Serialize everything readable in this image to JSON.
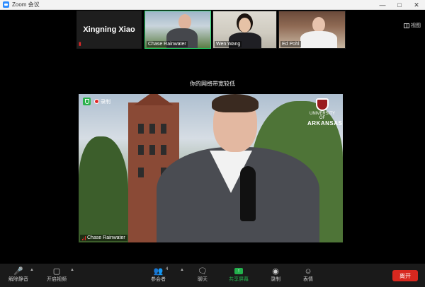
{
  "window": {
    "title": "Zoom 会议"
  },
  "gallery": {
    "view_label": "视图",
    "participants": [
      {
        "name": "Xingning Xiao",
        "video": false,
        "muted": true
      },
      {
        "name": "Chase Rainwater",
        "video": true,
        "speaking": true
      },
      {
        "name": "Wen Wang",
        "video": true
      },
      {
        "name": "Ed Pohl",
        "video": true
      }
    ]
  },
  "network_notice": "你的网络带宽较低",
  "main_video": {
    "name": "Chase Rainwater",
    "recording_label": "录制",
    "logo": {
      "line1": "UNIVERSITY OF",
      "line2": "ARKANSAS"
    }
  },
  "toolbar": {
    "mute_label": "解除静音",
    "video_label": "开启视频",
    "participants_label": "参会者",
    "participants_count": "4",
    "chat_label": "聊天",
    "share_label": "共享屏幕",
    "record_label": "录制",
    "reactions_label": "表情",
    "end_label": "离开"
  },
  "colors": {
    "accent_green": "#23b14d",
    "end_red": "#d8281f",
    "mute_red": "#e02828",
    "zoom_blue": "#2d8cff"
  }
}
